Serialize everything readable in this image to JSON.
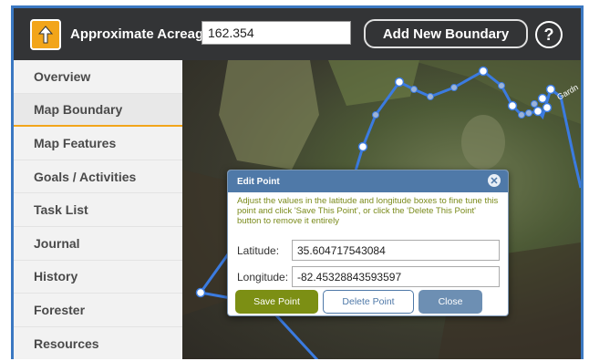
{
  "header": {
    "acreage_label": "Approximate Acreage:",
    "acreage_value": "162.354",
    "add_boundary_label": "Add New Boundary",
    "help_symbol": "?",
    "upload_icon": "upload-arrow-icon"
  },
  "sidebar": {
    "items": [
      {
        "label": "Overview"
      },
      {
        "label": "Map Boundary"
      },
      {
        "label": "Map Features"
      },
      {
        "label": "Goals / Activities"
      },
      {
        "label": "Task List"
      },
      {
        "label": "Journal"
      },
      {
        "label": "History"
      },
      {
        "label": "Forester"
      },
      {
        "label": "Resources"
      }
    ],
    "active_index": 1
  },
  "map": {
    "road_label": "Gardn",
    "boundary_color": "#3b7be0"
  },
  "dialog": {
    "title": "Edit Point",
    "close_symbol": "✕",
    "help_text": "Adjust the values in the latitude and longitude boxes to fine tune this point and click 'Save This Point', or click the 'Delete This Point' button to remove it entirely",
    "latitude_label": "Latitude:",
    "latitude_value": "35.604717543084",
    "longitude_label": "Longitude:",
    "longitude_value": "-82.45328843593597",
    "save_label": "Save Point",
    "delete_label": "Delete Point",
    "close_label": "Close"
  },
  "colors": {
    "accent": "#f2a51a",
    "header_bg": "#333436",
    "dialog_header": "#4f79a8",
    "save_button": "#7c8f14"
  }
}
